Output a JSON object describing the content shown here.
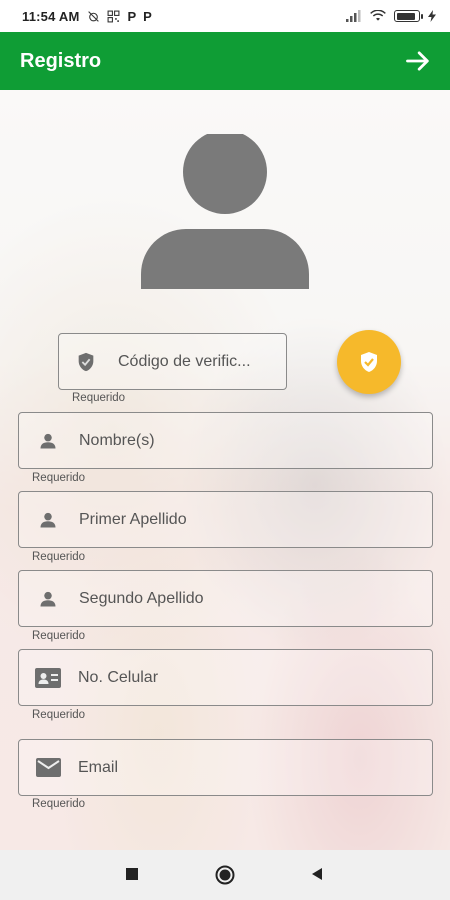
{
  "status_bar": {
    "time": "11:54 AM",
    "indicator_1": "P",
    "indicator_2": "P",
    "battery_level": 0.9
  },
  "app_bar": {
    "title": "Registro",
    "next_icon": "arrow-right-icon"
  },
  "form": {
    "verification": {
      "placeholder": "Código de verific...",
      "helper": "Requerido",
      "icon": "shield-icon"
    },
    "fab_icon": "shield-check-icon",
    "fields": [
      {
        "placeholder": "Nombre(s)",
        "helper": "Requerido",
        "icon": "person-icon"
      },
      {
        "placeholder": "Primer Apellido",
        "helper": "Requerido",
        "icon": "person-icon"
      },
      {
        "placeholder": "Segundo Apellido",
        "helper": "Requerido",
        "icon": "person-icon"
      },
      {
        "placeholder": "No. Celular",
        "helper": "Requerido",
        "icon": "contact-card-icon"
      },
      {
        "placeholder": "Email",
        "helper": "Requerido",
        "icon": "mail-icon"
      }
    ]
  },
  "colors": {
    "app_bar": "#0f9d35",
    "fab": "#f6b92b",
    "avatar": "#7a7a7a"
  }
}
